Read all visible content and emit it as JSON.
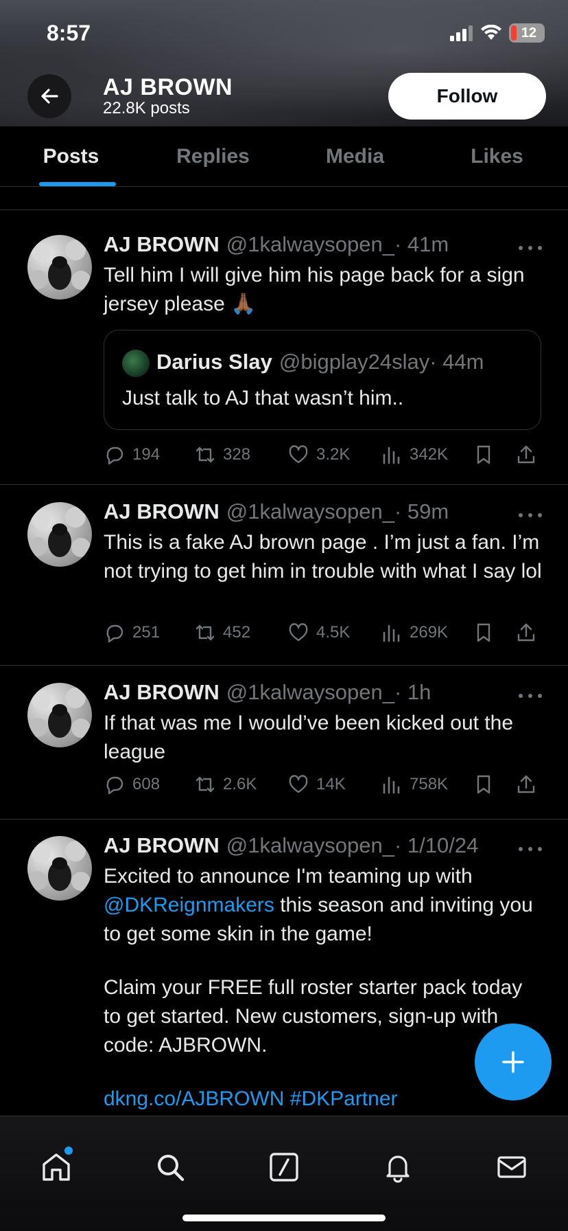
{
  "status_bar": {
    "time": "8:57",
    "battery": "12"
  },
  "profile": {
    "name": "AJ BROWN",
    "post_count": "22.8K posts",
    "follow_label": "Follow"
  },
  "tabs": [
    {
      "label": "Posts"
    },
    {
      "label": "Replies"
    },
    {
      "label": "Media"
    },
    {
      "label": "Likes"
    }
  ],
  "tweets": [
    {
      "name": "AJ BROWN",
      "handle": "@1kalwaysopen_",
      "time": "· 41m",
      "text": "Tell him I will give him his page back for a sign jersey please 🙏🏾",
      "quote": {
        "name": "Darius Slay",
        "handle": "@bigplay24slay",
        "time": "· 44m",
        "text": "Just talk to AJ that wasn’t him.."
      },
      "stats": {
        "replies": "194",
        "reposts": "328",
        "likes": "3.2K",
        "views": "342K"
      }
    },
    {
      "name": "AJ BROWN",
      "handle": "@1kalwaysopen_",
      "time": "· 59m",
      "text": "This is a fake AJ brown page . I’m just a fan. I’m not trying to get him in trouble with what I say lol",
      "stats": {
        "replies": "251",
        "reposts": "452",
        "likes": "4.5K",
        "views": "269K"
      }
    },
    {
      "name": "AJ BROWN",
      "handle": "@1kalwaysopen_",
      "time": "· 1h",
      "text": "If that was me I would’ve been kicked out the league",
      "stats": {
        "replies": "608",
        "reposts": "2.6K",
        "likes": "14K",
        "views": "758K"
      }
    },
    {
      "name": "AJ BROWN",
      "handle": "@1kalwaysopen_",
      "time": "· 1/10/24",
      "text_part1": "Excited to announce I'm teaming up with ",
      "mention": "@DKReignmakers",
      "text_part2": " this season and inviting you to get some skin in the game!",
      "text_para2": "Claim your FREE full roster starter pack today to get started. New customers, sign-up with code: AJBROWN.",
      "link": "dkng.co/AJBROWN",
      "hashtag": "#DKPartner"
    }
  ],
  "icons": {
    "back": "arrow-left-icon",
    "reply": "comment-icon",
    "repost": "repost-icon",
    "like": "heart-icon",
    "views": "bar-chart-icon",
    "bookmark": "bookmark-icon",
    "share": "share-icon",
    "compose": "plus-icon",
    "home": "home-icon",
    "search": "search-icon",
    "grok": "slash-box-icon",
    "notifications": "bell-icon",
    "messages": "mail-icon"
  },
  "colors": {
    "accent": "#1d9bf0",
    "background": "#000000",
    "muted": "#71767b",
    "text": "#e7e9ea"
  }
}
